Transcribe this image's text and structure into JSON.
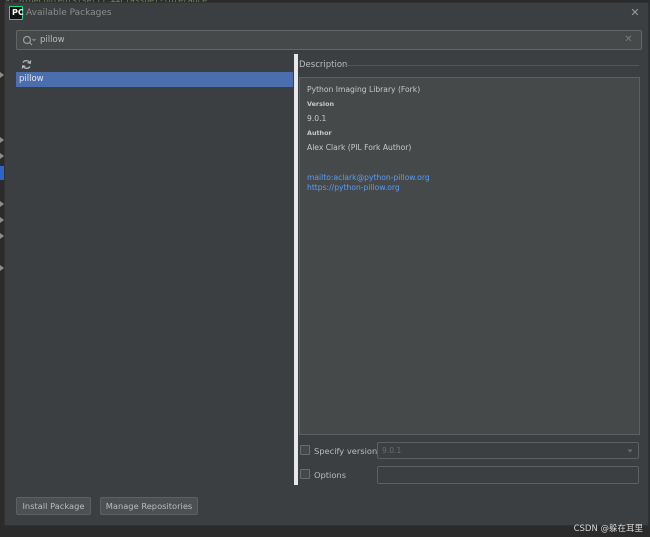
{
  "window": {
    "title": "Available Packages",
    "app_icon": "pycharm-icon",
    "close_icon": "close-icon"
  },
  "search": {
    "value": "pillow",
    "icon": "search-icon",
    "clear_icon": "clear-icon"
  },
  "packages": {
    "refresh_icon": "refresh-icon",
    "items": [
      "pillow"
    ],
    "selected": "pillow"
  },
  "description": {
    "header": "Description",
    "summary": "Python Imaging Library (Fork)",
    "version_label": "Version",
    "version_value": "9.0.1",
    "author_label": "Author",
    "author_value": "Alex Clark (PIL Fork Author)",
    "email_link": "mailto:aclark@python-pillow.org",
    "home_link": "https://python-pillow.org"
  },
  "options": {
    "specify_version_label": "Specify version",
    "specify_version_value": "9.0.1",
    "options_label": "Options",
    "options_value": ""
  },
  "buttons": {
    "install": "Install Package",
    "manage": "Manage Repositories"
  },
  "watermark": "CSDN @躲在耳里",
  "colors": {
    "selection": "#4b6eaf",
    "link": "#589df6",
    "dialog_bg": "#3c3f41"
  }
}
